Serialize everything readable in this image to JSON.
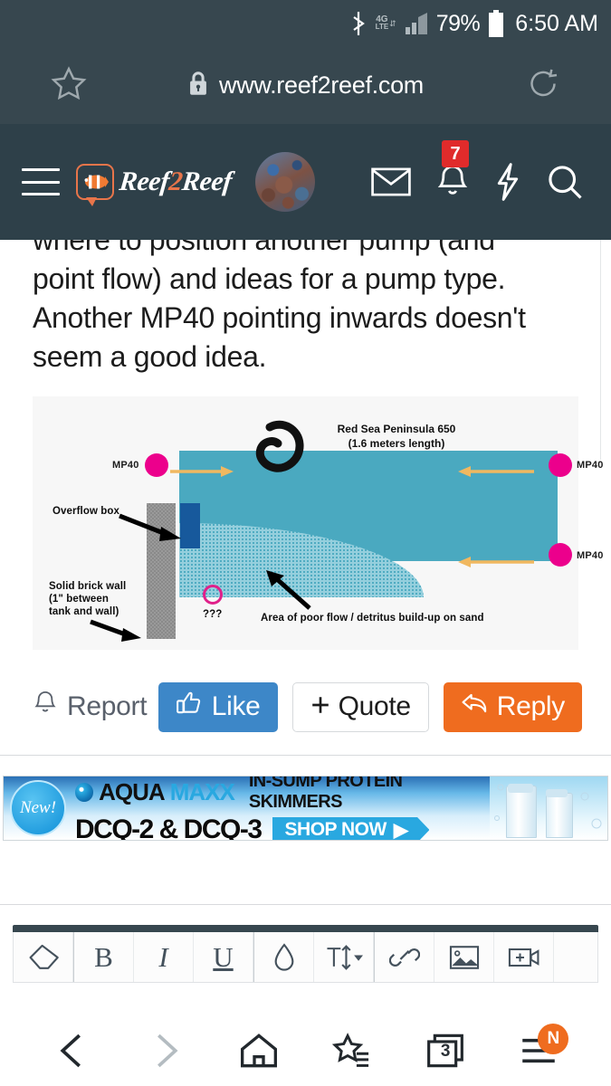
{
  "statusbar": {
    "bluetooth_icon": "bluetooth-icon",
    "network_label_top": "4G",
    "network_label_bottom": "LTE",
    "signal_icon": "signal-bars-icon",
    "battery_percent": "79%",
    "battery_icon": "battery-icon",
    "time": "6:50 AM"
  },
  "browser_urlbar": {
    "bookmark_icon": "star-icon",
    "lock_icon": "lock-icon",
    "url": "www.reef2reef.com",
    "reload_icon": "reload-icon"
  },
  "site_header": {
    "menu_icon": "hamburger-menu-icon",
    "logo_text_1": "Reef",
    "logo_text_2": "2",
    "logo_text_3": "Reef",
    "logo_icon": "clownfish-speech-bubble-icon",
    "avatar_alt": "user-avatar",
    "inbox_icon": "envelope-icon",
    "alerts_icon": "bell-icon",
    "alerts_count": "7",
    "bolt_icon": "lightning-bolt-icon",
    "search_icon": "search-icon"
  },
  "post": {
    "clipped_line": "where to position another pump (and",
    "line2": "point flow) and ideas for a pump type.",
    "line3": "Another MP40 pointing inwards doesn't",
    "line4": "seem a good idea."
  },
  "diagram": {
    "title_line1": "Red Sea Peninsula 650",
    "title_line2": "(1.6 meters length)",
    "label_overflow": "Overflow box",
    "label_wall_line1": "Solid brick wall",
    "label_wall_line2": "(1\" between",
    "label_wall_line3": "tank and wall)",
    "label_question": "???",
    "label_poor_flow": "Area of poor flow / detritus build-up on sand",
    "pump_label_left": "MP40",
    "pump_label_right_top": "MP40",
    "pump_label_right_bottom": "MP40",
    "colors": {
      "tank_water": "#4aa9c0",
      "sand_haze": "#95cfdd",
      "pump_marker": "#ec008c",
      "flow_arrow": "#f0b860",
      "overflow_box": "#17599c",
      "brick_wall": "#9a9a9a",
      "question_circle": "#e0218a",
      "annotation": "#000000"
    }
  },
  "actions": {
    "report_icon": "bell-icon",
    "report_label": "Report",
    "like_icon": "thumbs-up-icon",
    "like_label": "Like",
    "quote_icon": "plus-icon",
    "quote_label": "Quote",
    "reply_icon": "reply-arrow-icon",
    "reply_label": "Reply",
    "colors": {
      "like": "#3d87c8",
      "reply": "#ef6c1f"
    }
  },
  "ad": {
    "badge": "New!",
    "brand_part1": "AQUA",
    "brand_part2": "MAXX",
    "brand_icon": "water-swirl-icon",
    "headline": "IN-SUMP PROTEIN SKIMMERS",
    "product": "DCQ-2 & DCQ-3",
    "cta": "SHOP NOW",
    "cta_icon": "play-arrow-icon",
    "product_image_alt": "protein-skimmer-product-photo"
  },
  "editor_toolbar": {
    "buttons": [
      {
        "name": "eraser-icon",
        "label": "Remove formatting"
      },
      {
        "name": "bold-icon",
        "label": "B"
      },
      {
        "name": "italic-icon",
        "label": "I"
      },
      {
        "name": "underline-icon",
        "label": "U"
      },
      {
        "name": "droplet-icon",
        "label": "Text color"
      },
      {
        "name": "font-size-icon",
        "label": "Font size"
      },
      {
        "name": "link-icon",
        "label": "Insert link"
      },
      {
        "name": "image-icon",
        "label": "Insert image"
      },
      {
        "name": "video-icon",
        "label": "Insert video"
      }
    ]
  },
  "bottom_nav": {
    "back_icon": "chevron-left-icon",
    "forward_icon": "chevron-right-icon",
    "home_icon": "home-icon",
    "bookmarks_icon": "bookmarks-star-icon",
    "tabs_icon": "tabs-icon",
    "tabs_count": "3",
    "menu_icon": "menu-lines-icon",
    "menu_badge": "N"
  }
}
